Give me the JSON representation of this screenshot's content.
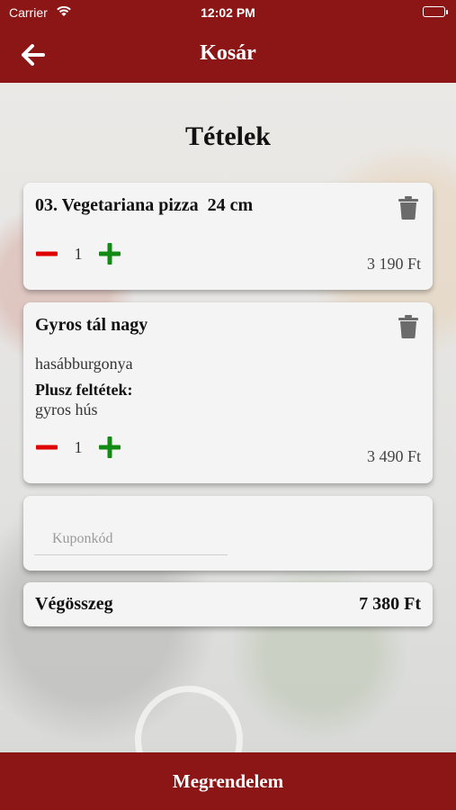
{
  "status_bar": {
    "carrier": "Carrier",
    "time": "12:02 PM"
  },
  "header": {
    "title": "Kosár",
    "back_icon": "arrow-left-icon"
  },
  "section_title": "Tételek",
  "items": [
    {
      "name": "03. Vegetariana pizza  24 cm",
      "quantity": "1",
      "price": "3 190 Ft"
    },
    {
      "name": "Gyros tál nagy",
      "side": "hasábburgonya",
      "extras_label": "Plusz feltétek:",
      "extras": "gyros hús",
      "quantity": "1",
      "price": "3 490 Ft"
    }
  ],
  "coupon": {
    "placeholder": "Kuponkód"
  },
  "total": {
    "label": "Végösszeg",
    "value": "7 380 Ft"
  },
  "order_button": "Megrendelem",
  "colors": {
    "brand": "#8c1515",
    "minus": "#e00000",
    "plus": "#138a13",
    "trash": "#6b6b6b"
  }
}
